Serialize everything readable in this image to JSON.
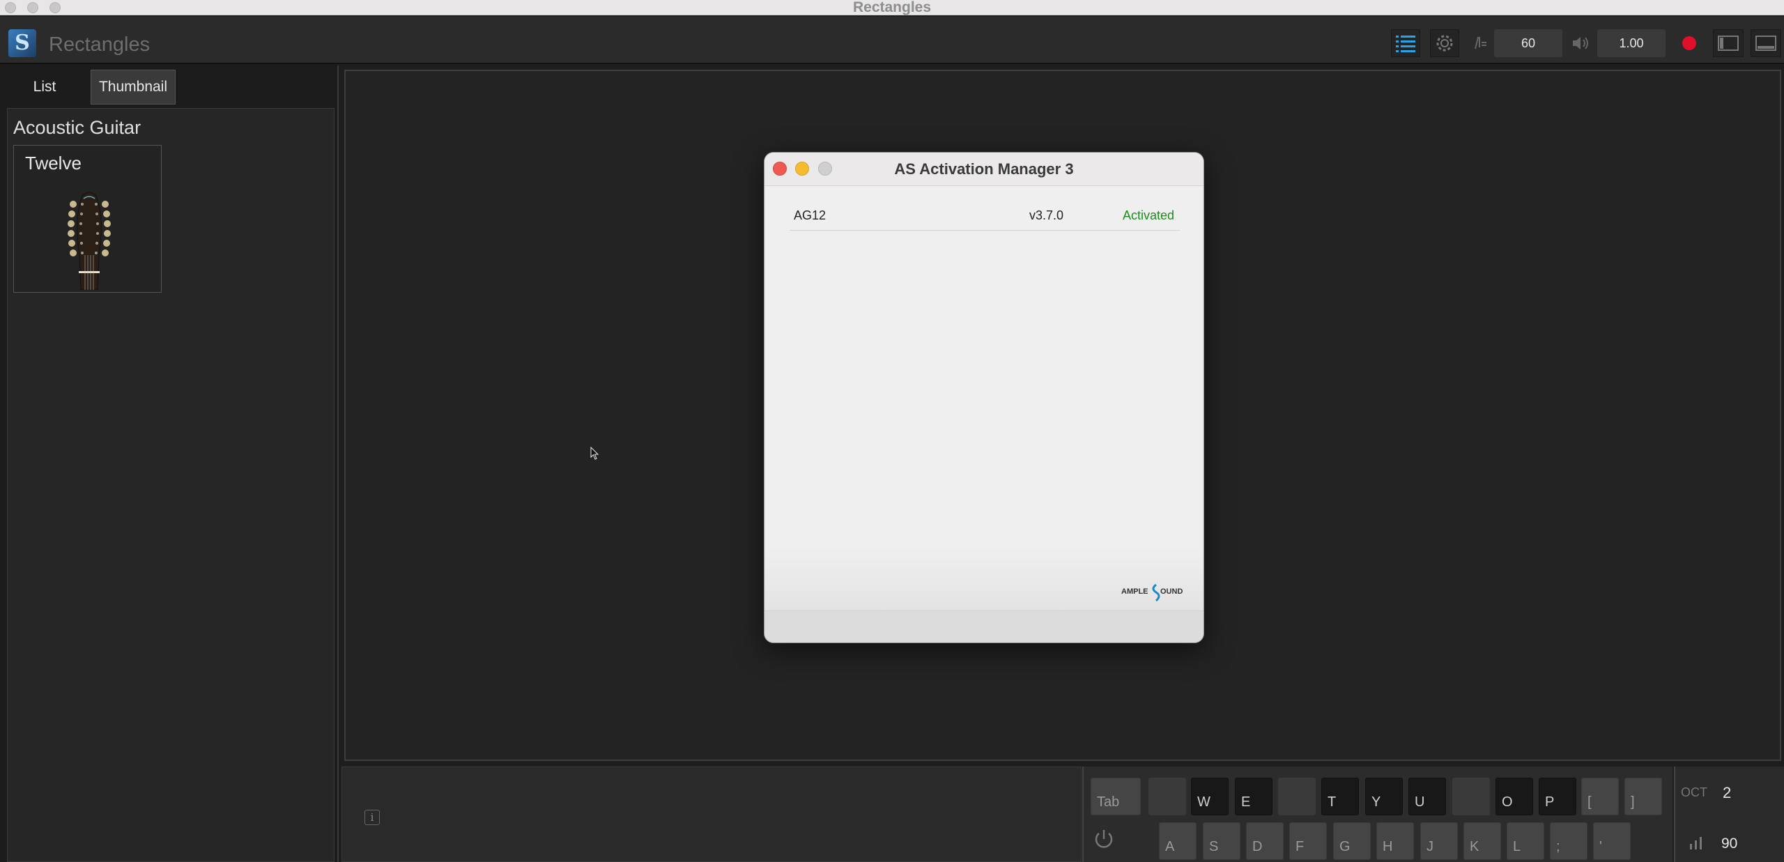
{
  "os_window": {
    "title": "Rectangles"
  },
  "app": {
    "name": "Rectangles"
  },
  "toolbar": {
    "tempo": "60",
    "volume": "1.00"
  },
  "library": {
    "tabs": [
      "List",
      "Thumbnail"
    ],
    "active_tab": "Thumbnail",
    "category": "Acoustic Guitar",
    "instrument": "Twelve"
  },
  "dialog": {
    "title": "AS Activation Manager 3",
    "products": [
      {
        "name": "AG12",
        "version": "v3.7.0",
        "status": "Activated"
      }
    ],
    "brand": "AMPLE SOUND"
  },
  "keyboard": {
    "top_row": [
      {
        "label": "Tab",
        "style": "gray"
      },
      {
        "label": "",
        "style": "white"
      },
      {
        "label": "W",
        "style": "black"
      },
      {
        "label": "E",
        "style": "black"
      },
      {
        "label": "",
        "style": "white"
      },
      {
        "label": "T",
        "style": "black"
      },
      {
        "label": "Y",
        "style": "black"
      },
      {
        "label": "U",
        "style": "black"
      },
      {
        "label": "",
        "style": "white"
      },
      {
        "label": "O",
        "style": "black"
      },
      {
        "label": "P",
        "style": "black"
      },
      {
        "label": "[",
        "style": "gray"
      },
      {
        "label": "]",
        "style": "gray"
      }
    ],
    "bottom_row": [
      "A",
      "S",
      "D",
      "F",
      "G",
      "H",
      "J",
      "K",
      "L",
      ";",
      "'"
    ]
  },
  "status": {
    "oct_label": "OCT",
    "oct_value": "2",
    "velocity": "90"
  },
  "colors": {
    "accent_blue": "#2aa3e6",
    "record_red": "#e0102a",
    "activated_green": "#1e8a1e"
  }
}
